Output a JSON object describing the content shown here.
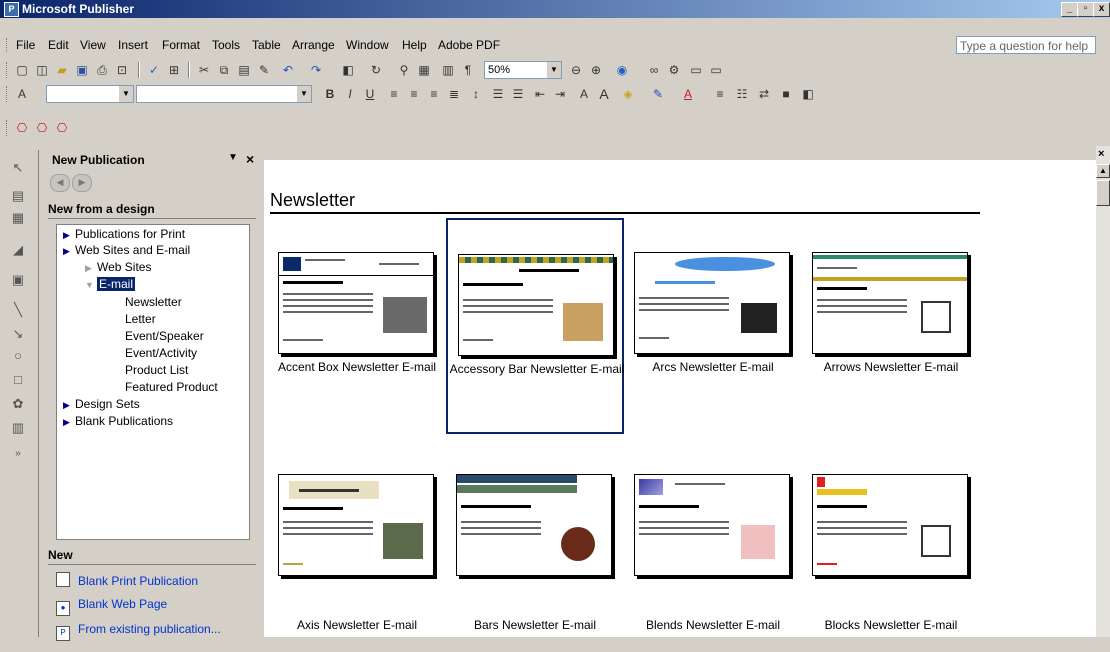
{
  "window": {
    "title": "Microsoft Publisher",
    "buttons": [
      "_",
      "▫",
      "x"
    ]
  },
  "menu": {
    "items": [
      "File",
      "Edit",
      "View",
      "Insert",
      "Format",
      "Tools",
      "Table",
      "Arrange",
      "Window",
      "Help",
      "Adobe PDF"
    ],
    "ask_placeholder": "Type a question for help"
  },
  "toolbar": {
    "zoom": "50%"
  },
  "taskpane": {
    "title": "New Publication",
    "section_design": "New from a design",
    "tree": {
      "publications_print": "Publications for Print",
      "web_email": "Web Sites and E-mail",
      "web_sites": "Web Sites",
      "email": "E-mail",
      "newsletter": "Newsletter",
      "letter": "Letter",
      "event_speaker": "Event/Speaker",
      "event_activity": "Event/Activity",
      "product_list": "Product List",
      "featured_product": "Featured Product",
      "design_sets": "Design Sets",
      "blank_publications": "Blank Publications"
    },
    "section_new": "New",
    "new_links": [
      "Blank Print Publication",
      "Blank Web Page",
      "From existing publication..."
    ]
  },
  "gallery": {
    "title": "Newsletter",
    "items": [
      {
        "label": "Accent Box Newsletter E-mail",
        "accent": "#0a2a6a"
      },
      {
        "label": "Accessory Bar Newsletter E-mail",
        "accent": "#c8a020"
      },
      {
        "label": "Arcs Newsletter E-mail",
        "accent": "#4a90e0"
      },
      {
        "label": "Arrows Newsletter E-mail",
        "accent": "#2a8a6a"
      },
      {
        "label": "Axis Newsletter E-mail",
        "accent": "#c0a040"
      },
      {
        "label": "Bars Newsletter E-mail",
        "accent": "#2a4a6a"
      },
      {
        "label": "Blends Newsletter E-mail",
        "accent": "#3a3aa0"
      },
      {
        "label": "Blocks Newsletter E-mail",
        "accent": "#e02020"
      }
    ],
    "selected_index": 1
  }
}
